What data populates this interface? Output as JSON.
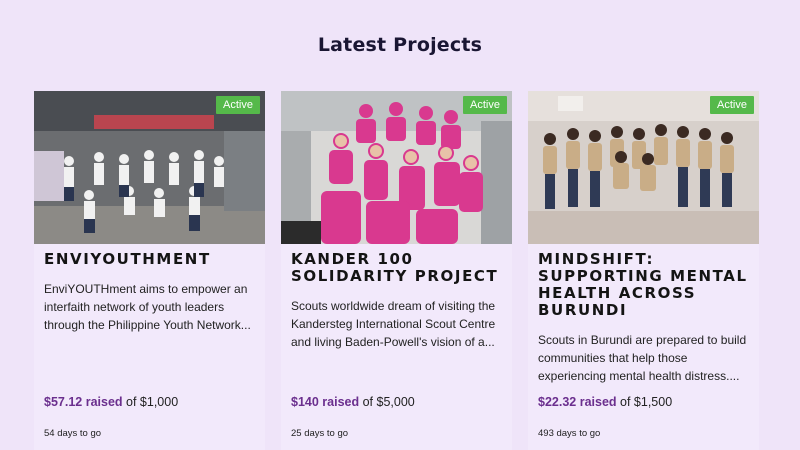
{
  "section_title": "Latest Projects",
  "projects": [
    {
      "status": "Active",
      "title": "EnviYOUTHment",
      "description": "EnviYOUTHment aims to empower an interfaith network of youth leaders through the Philippine Youth Network...",
      "raised_amount": "$57.12 raised",
      "goal_text": "of $1,000",
      "days_left": "54 days to go",
      "image": "group-photo-youth-leaders"
    },
    {
      "status": "Active",
      "title": "Kander 100 Solidarity Project",
      "description": "Scouts worldwide dream of visiting the Kandersteg International Scout Centre and living Baden-Powell's vision of a...",
      "raised_amount": "$140 raised",
      "goal_text": "of $5,000",
      "days_left": "25 days to go",
      "image": "group-photo-scouts-pink-shirts"
    },
    {
      "status": "Active",
      "title": "Mindshift: Supporting Mental Health Across Burundi",
      "description": "Scouts in Burundi are prepared to build communities that help those experiencing mental health distress....",
      "raised_amount": "$22.32 raised",
      "goal_text": "of $1,500",
      "days_left": "493 days to go",
      "image": "group-photo-burundi-scouts"
    }
  ],
  "colors": {
    "page_background": "#efe4f9",
    "card_background": "#f2e9fb",
    "badge_green": "#55b94a",
    "raised_purple": "#6b2f8e"
  }
}
